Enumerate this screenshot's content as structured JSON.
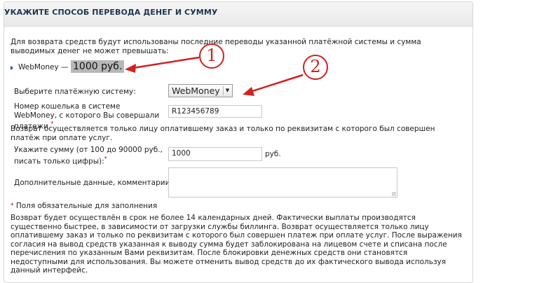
{
  "panel": {
    "title": "УКАЖИТЕ СПОСОБ ПЕРЕВОДА ДЕНЕГ И СУММУ"
  },
  "intro_text": "Для возврата средств будут использованы последние переводы указанной платёжной системы и сумма выводимых денег не может превышать:",
  "limit": {
    "system": "WebMoney —",
    "amount": "1000 руб."
  },
  "form": {
    "payment_system": {
      "label": "Выберите платёжную систему:",
      "value": "WebMoney"
    },
    "wallet": {
      "label": "Номер кошелька в системе WebMoney, с которого Вы совершали платежи.",
      "required_mark": "*",
      "value": "R123456789"
    },
    "refund_note": "Возврат осуществляется только лицу оплатившему заказ и только по реквизитам с которого был совершен платёж при оплате услуг.",
    "amount": {
      "label": "Укажите сумму (от 100 до 90000 руб., писать только цифры):",
      "required_mark": "*",
      "value": "1000",
      "unit": "руб."
    },
    "comments": {
      "label": "Дополнительные данные, комментарии",
      "value": ""
    }
  },
  "required_note": {
    "mark": "*",
    "text": " Поля обязательные для заполнения"
  },
  "bottom_text": "Возврат будет осуществлён в срок не более 14 календарных дней. Фактически выплаты производятся существенно быстрее, в зависимости от загрузки службы биллинга. Возврат осуществляется только лицу оплатившему заказ и только по реквизитам с которого был совершен платеж при оплате услуг. После выражения согласия на вывод средств указанная к выводу сумма будет заблокирована на лицевом счете и списана после перечисления по указанным Вами реквизитам. После блокировки денежных средств они становятся недоступными для использования. Вы можете отменить вывод средств до их фактического вывода используя данный интерфейс.",
  "annotations": {
    "callout_1": "1",
    "callout_2": "2",
    "color": "#d32020"
  },
  "colors": {
    "title": "#1d3550",
    "required": "#cc0000",
    "amount_highlight": "#b8b8b8"
  }
}
